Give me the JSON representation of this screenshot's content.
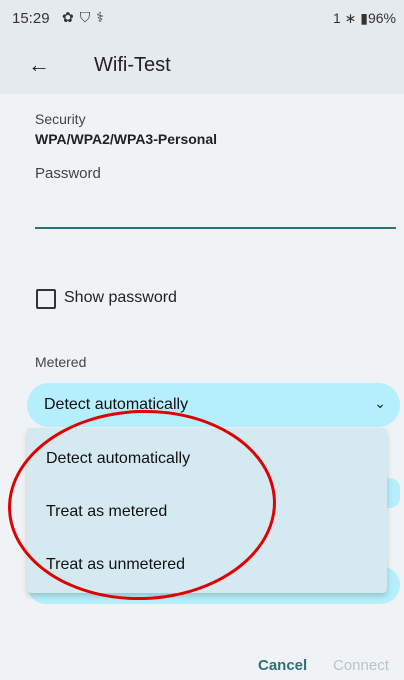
{
  "status_bar": {
    "time": "15:29",
    "left_icons": [
      "settings-icon",
      "vpn-shield-icon",
      "usb-debug-icon"
    ],
    "right_text": "1  ∗  ▮96%"
  },
  "app_bar": {
    "back_glyph": "←",
    "title": "Wifi-Test"
  },
  "security": {
    "label": "Security",
    "value": "WPA/WPA2/WPA3-Personal"
  },
  "password": {
    "label": "Password",
    "value": ""
  },
  "show_password": {
    "label": "Show password",
    "checked": false
  },
  "metered": {
    "label": "Metered",
    "selected": "Detect automatically",
    "chevron": "⌄",
    "options": [
      "Detect automatically",
      "Treat as metered",
      "Treat as unmetered"
    ]
  },
  "footer": {
    "cancel": "Cancel",
    "connect": "Connect"
  },
  "colors": {
    "accent": "#2f6f79",
    "dropdown_bg": "#b5eefc",
    "menu_bg": "#d5e9f1",
    "annotation": "#e00000"
  }
}
